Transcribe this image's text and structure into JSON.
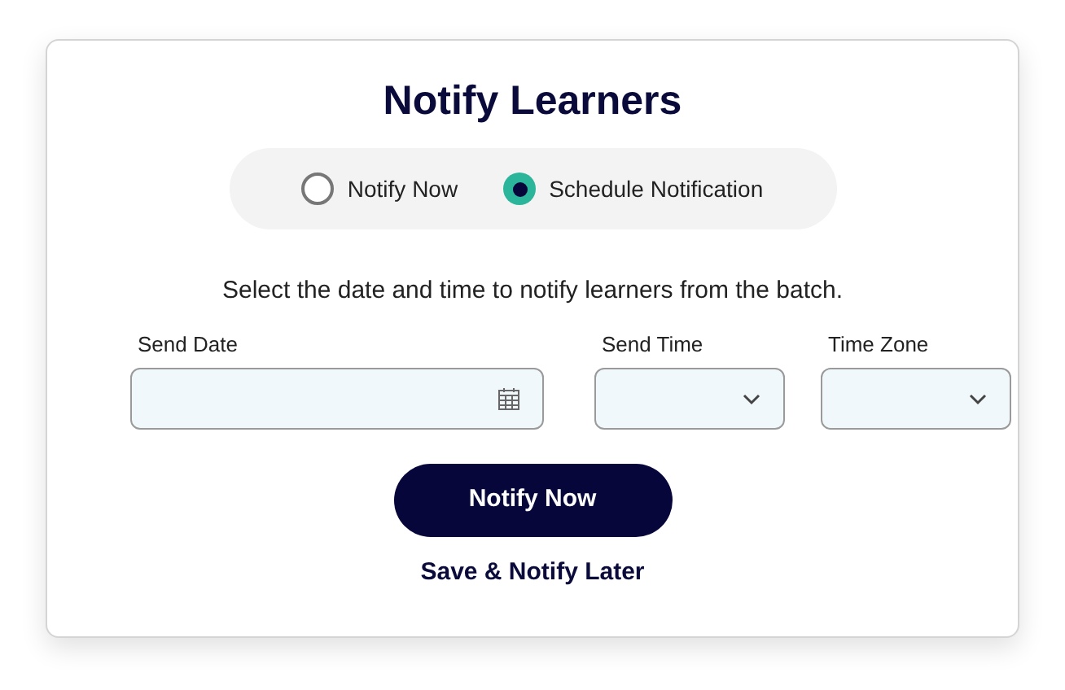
{
  "dialog": {
    "title": "Notify Learners",
    "options": [
      {
        "label": "Notify Now",
        "selected": false
      },
      {
        "label": "Schedule Notification",
        "selected": true
      }
    ],
    "instruction": "Select the date and time to notify learners from the batch.",
    "fields": [
      {
        "label": "Send Date",
        "kind": "date"
      },
      {
        "label": "Send Time",
        "kind": "select"
      },
      {
        "label": "Time Zone",
        "kind": "select"
      }
    ],
    "primary_button": "Notify Now",
    "secondary_link": "Save & Notify Later"
  }
}
